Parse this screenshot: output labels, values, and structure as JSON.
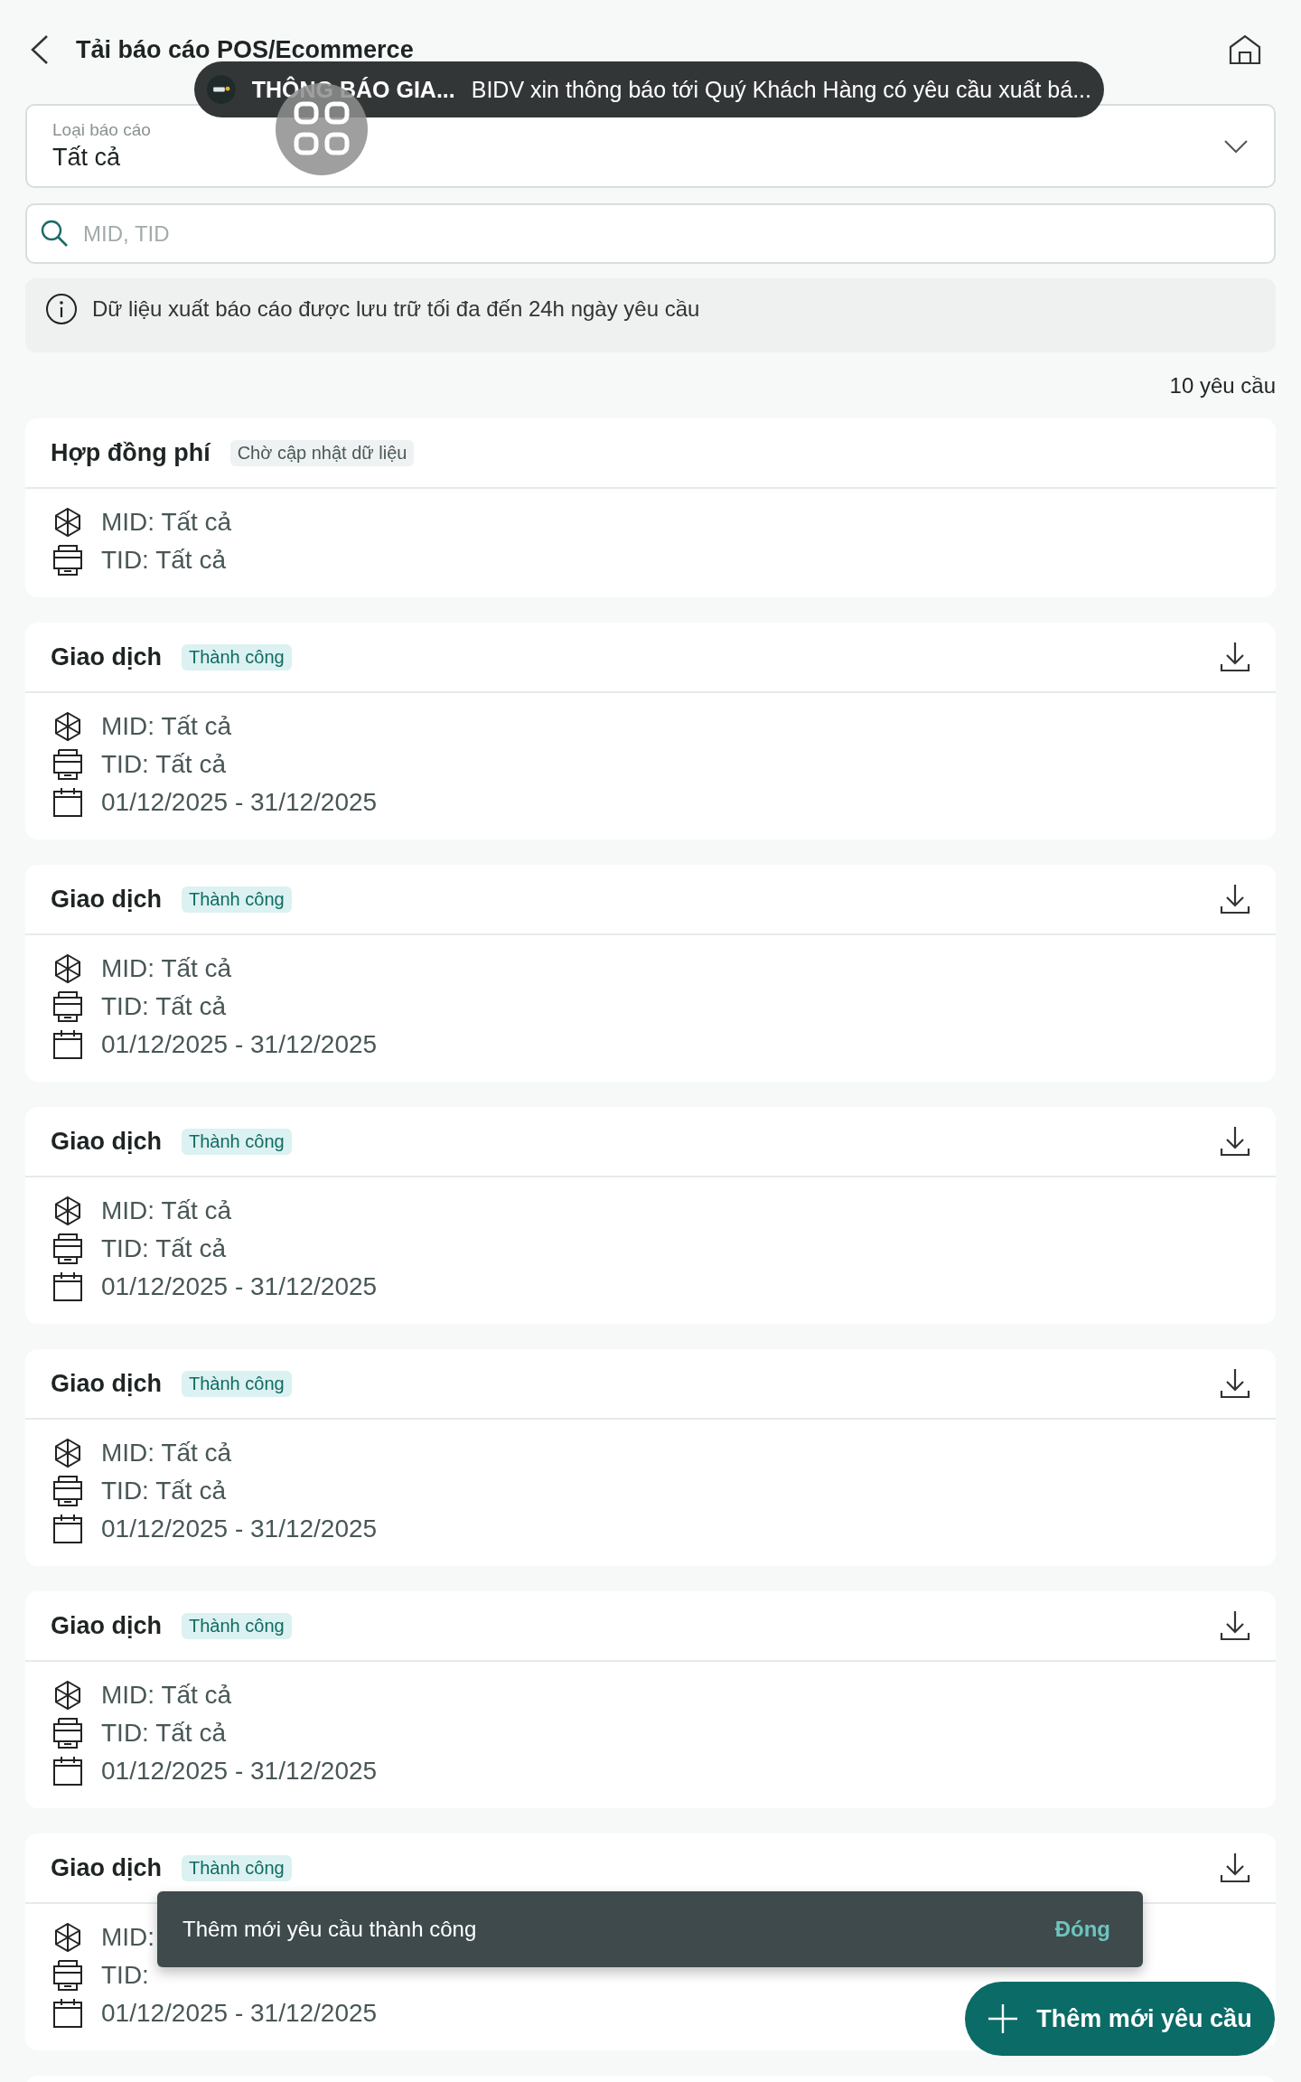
{
  "header": {
    "title": "Tải báo cáo POS/Ecommerce"
  },
  "notification": {
    "app_title": "THÔNG BÁO GIA...",
    "message": "BIDV xin thông báo tới Quý Khách Hàng có yêu cầu xuất bá..."
  },
  "report_type": {
    "label": "Loại báo cáo",
    "value": "Tất cả"
  },
  "search": {
    "placeholder": "MID, TID"
  },
  "info": "Dữ liệu xuất báo cáo được lưu trữ tối đa đến 24h ngày yêu cầu",
  "count": "10 yêu cầu",
  "requests": [
    {
      "title": "Hợp đồng phí",
      "status": "Chờ cập nhật dữ liệu",
      "kind": "pending",
      "downloadable": false,
      "mid": "MID: Tất cả",
      "tid": "TID: Tất cả"
    },
    {
      "title": "Giao dịch",
      "status": "Thành công",
      "kind": "success",
      "downloadable": true,
      "mid": "MID: Tất cả",
      "tid": "TID: Tất cả",
      "period": "01/12/2025 - 31/12/2025"
    },
    {
      "title": "Giao dịch",
      "status": "Thành công",
      "kind": "success",
      "downloadable": true,
      "mid": "MID: Tất cả",
      "tid": "TID: Tất cả",
      "period": "01/12/2025 - 31/12/2025"
    },
    {
      "title": "Giao dịch",
      "status": "Thành công",
      "kind": "success",
      "downloadable": true,
      "mid": "MID: Tất cả",
      "tid": "TID: Tất cả",
      "period": "01/12/2025 - 31/12/2025"
    },
    {
      "title": "Giao dịch",
      "status": "Thành công",
      "kind": "success",
      "downloadable": true,
      "mid": "MID: Tất cả",
      "tid": "TID: Tất cả",
      "period": "01/12/2025 - 31/12/2025"
    },
    {
      "title": "Giao dịch",
      "status": "Thành công",
      "kind": "success",
      "downloadable": true,
      "mid": "MID: Tất cả",
      "tid": "TID: Tất cả",
      "period": "01/12/2025 - 31/12/2025"
    },
    {
      "title": "Giao dịch",
      "status": "Thành công",
      "kind": "success",
      "downloadable": true,
      "mid": "MID:",
      "tid": "TID:",
      "period": "01/12/2025 - 31/12/2025"
    }
  ],
  "toast": {
    "message": "Thêm mới yêu cầu thành công",
    "action": "Đóng"
  },
  "add_button": "Thêm mới yêu cầu"
}
